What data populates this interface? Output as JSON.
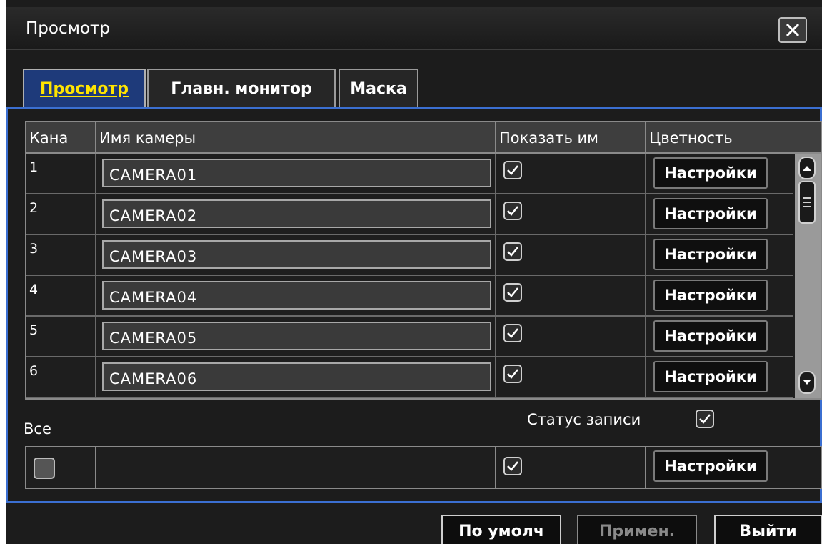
{
  "window": {
    "title": "Просмотр"
  },
  "tabs": [
    {
      "label": "Просмотр",
      "active": true
    },
    {
      "label": "Главн. монитор",
      "active": false
    },
    {
      "label": "Маска",
      "active": false
    }
  ],
  "table": {
    "columns": [
      "Кана",
      "Имя камеры",
      "Показать им",
      "Цветность"
    ],
    "rows": [
      {
        "channel": "1",
        "camera_name": "CAMERA01",
        "show_name": true,
        "color_label": "Настройки"
      },
      {
        "channel": "2",
        "camera_name": "CAMERA02",
        "show_name": true,
        "color_label": "Настройки"
      },
      {
        "channel": "3",
        "camera_name": "CAMERA03",
        "show_name": true,
        "color_label": "Настройки"
      },
      {
        "channel": "4",
        "camera_name": "CAMERA04",
        "show_name": true,
        "color_label": "Настройки"
      },
      {
        "channel": "5",
        "camera_name": "CAMERA05",
        "show_name": true,
        "color_label": "Настройки"
      },
      {
        "channel": "6",
        "camera_name": "CAMERA06",
        "show_name": true,
        "color_label": "Настройки"
      }
    ]
  },
  "all_section": {
    "label": "Все",
    "record_status_label": "Статус записи",
    "record_status_checked": true,
    "all_checked": false,
    "show_name_checked": true,
    "settings_label": "Настройки"
  },
  "buttons": {
    "default": "По умолч",
    "apply": "Примен.",
    "exit": "Выйти"
  },
  "icons": {
    "close": "close-icon",
    "check": "check-icon",
    "scroll_up": "chevron-up-icon",
    "scroll_down": "chevron-down-icon"
  },
  "colors": {
    "active_tab_text": "#ffe400",
    "active_tab_bg": "#1e3a7a",
    "panel_border": "#3b6fd1"
  }
}
